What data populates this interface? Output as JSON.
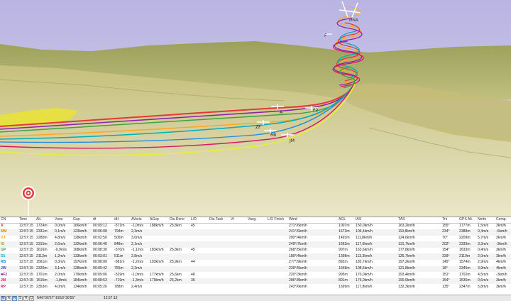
{
  "labels": {
    "A": "A",
    "F2": "F2",
    "ZF": "ZF",
    "RB": "RB",
    "JM": "JM",
    "F": "F",
    "MNA": "MNA"
  },
  "columns": [
    "CN",
    "Time",
    "Alt.",
    "Vario",
    "Gsp.",
    "dt",
    "dH",
    "AVario",
    "AGsp",
    "Dis.Done",
    "L/D",
    "Dis.Task",
    "Vt",
    "Vavg.",
    "L/D Finish",
    "Wind",
    "AGL",
    "IAS",
    "TAS",
    "Trk",
    "GPS Alt.",
    "Netto",
    "Comp."
  ],
  "rows": [
    {
      "cn": "A",
      "color": "#e53935",
      "cells": [
        "A",
        "12:57:15",
        "1724m",
        "0,0m/s",
        "166km/h",
        "00:09:12",
        "-571m",
        "-1,0m/s",
        "188km/h",
        "25,8km",
        "45",
        "",
        "",
        "",
        "",
        "271°/6km/h",
        "1007m",
        "150,0km/h",
        "163,2km/h",
        "155°",
        "1777m",
        "1,5m/s",
        "3km/h"
      ]
    },
    {
      "cn": "MM",
      "color": "#f57c00",
      "cells": [
        "MM",
        "12:57:15",
        "2331m",
        "0,1m/s",
        "123km/h",
        "00:06:08",
        "794m",
        "2,3m/s",
        "",
        "",
        "",
        "",
        "",
        "",
        "",
        "241°/6km/h",
        "1673m",
        "106,4km/h",
        "119,8km/h",
        "234°",
        "2388m",
        "0,4m/s",
        "-6km/h"
      ]
    },
    {
      "cn": "VJ",
      "color": "#f9a825",
      "cells": [
        "VJ",
        "12:57:15",
        "2280m",
        "4,8m/s",
        "128km/h",
        "00:02:50",
        "505m",
        "3,0m/s",
        "",
        "",
        "",
        "",
        "",
        "",
        "",
        "200°/4km/h",
        "1493m",
        "111,8km/h",
        "124,6km/h",
        "70°",
        "2209m",
        "5,7m/s",
        "3km/h"
      ]
    },
    {
      "cn": "IG",
      "color": "#9e9d24",
      "cells": [
        "IG",
        "12:57:15",
        "2315m",
        "2,6m/s",
        "132km/h",
        "00:06:40",
        "848m",
        "2,1m/s",
        "",
        "",
        "",
        "",
        "",
        "",
        "",
        "249°/7km/h",
        "1663m",
        "117,6km/h",
        "131,7km/h",
        "202°",
        "2333m",
        "3,3m/s",
        "-3km/h"
      ]
    },
    {
      "cn": "GP",
      "color": "#43a047",
      "cells": [
        "GP",
        "12:57:15",
        "1616m",
        "-0,9m/s",
        "168km/h",
        "00:08:30",
        "-570m",
        "-1,1m/s",
        "183km/h",
        "25,8km",
        "45",
        "",
        "",
        "",
        "",
        "268°/5km/h",
        "907m",
        "163,6km/h",
        "177,8km/h",
        "154°",
        "1633m",
        "0,4m/s",
        "3km/h"
      ]
    },
    {
      "cn": "D1",
      "color": "#00acc1",
      "cells": [
        "D1",
        "12:57:15",
        "2113m",
        "1,2m/s",
        "133km/h",
        "00:03:01",
        "511m",
        "2,8m/s",
        "",
        "",
        "",
        "",
        "",
        "",
        "",
        "189°/4km/h",
        "1398m",
        "113,3km/h",
        "125,7km/h",
        "339°",
        "2119m",
        "2,0m/s",
        "3km/h"
      ]
    },
    {
      "cn": "RB",
      "color": "#1e88e5",
      "cells": [
        "RB",
        "12:57:15",
        "1561m",
        "0,3m/s",
        "197km/h",
        "00:08:00",
        "-581m",
        "-1,2m/s",
        "193km/h",
        "25,9km",
        "44",
        "",
        "",
        "",
        "",
        "277°/9km/h",
        "892m",
        "182,7km/h",
        "197,2km/h",
        "145°",
        "1574m",
        "2,9m/s",
        "4km/h"
      ]
    },
    {
      "cn": "JW",
      "color": "#3949ab",
      "cells": [
        "JW",
        "12:57:15",
        "2320m",
        "3,1m/s",
        "128km/h",
        "00:05:42",
        "755m",
        "2,2m/s",
        "",
        "",
        "",
        "",
        "",
        "",
        "",
        "239°/5km/h",
        "1648m",
        "108,6km/h",
        "121,8km/h",
        "18°",
        "2345m",
        "3,9m/s",
        "4km/h"
      ]
    },
    {
      "cn": "F2",
      "color": "#8e24aa",
      "cells": [
        "■F2",
        "12:57:15",
        "1701m",
        "2,0m/s",
        "179km/h",
        "00:09:00",
        "-529m",
        "-1,0m/s",
        "177km/h",
        "25,6km",
        "48",
        "",
        "",
        "",
        "",
        "220°/3km/h",
        "995m",
        "170,0km/h",
        "193,4km/h",
        "151°",
        "1702m",
        "4,5m/s",
        "-3km/h"
      ]
    },
    {
      "cn": "JM",
      "color": "#d81b60",
      "cells": [
        "JM",
        "12:57:15",
        "1515m",
        "-1,8m/s",
        "184km/h",
        "00:08:53",
        "-719m",
        "-1,3m/s",
        "179km/h",
        "26,2km",
        "36",
        "",
        "",
        "",
        "",
        "286°/8km/h",
        "801m",
        "176,0km/h",
        "190,9km/h",
        "154°",
        "1536m",
        "0,6m/s",
        "3km/h"
      ]
    },
    {
      "cn": "RP",
      "color": "#c2185b",
      "cells": [
        "RP",
        "12:57:15",
        "2353m",
        "4,0m/s",
        "134km/h",
        "00:05:26",
        "788m",
        "2,4m/s",
        "",
        "",
        "",
        "",
        "",
        "",
        "",
        "243°/6km/h",
        "1699m",
        "117,8km/h",
        "132,3km/h",
        "135°",
        "2347m",
        "5,8m/s",
        "3km/h"
      ]
    }
  ],
  "statusbar": {
    "buttons": [
      "M",
      "A",
      "R",
      "S",
      "H",
      "Q"
    ],
    "coords": "N46°06'57\"  E016°36'55\"",
    "time": "12:57:15"
  }
}
